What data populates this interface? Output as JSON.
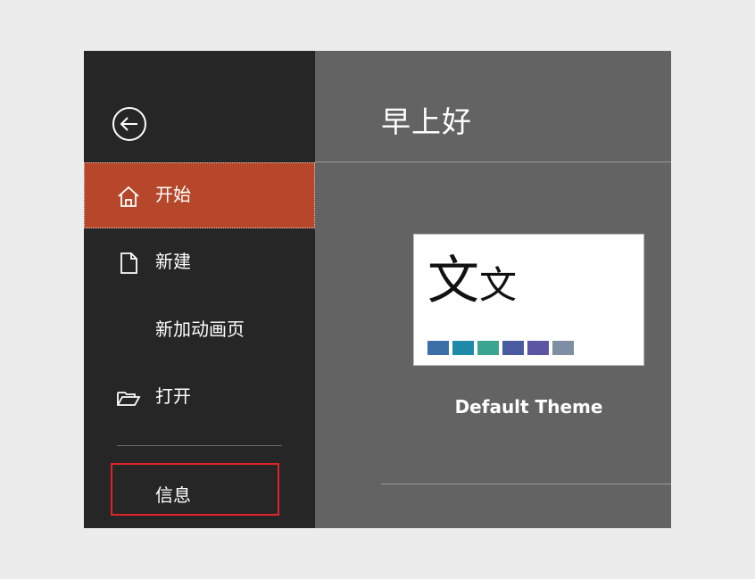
{
  "greeting": "早上好",
  "sidebar": {
    "back_icon": "back-arrow-circle-icon",
    "items": [
      {
        "label": "开始",
        "icon": "home-icon",
        "active": true
      },
      {
        "label": "新建",
        "icon": "new-document-icon"
      },
      {
        "label": "新加动画页"
      },
      {
        "label": "打开",
        "icon": "open-folder-icon"
      },
      {
        "label": "信息",
        "highlighted": true
      }
    ]
  },
  "theme": {
    "name": "Default Theme",
    "sample_big": "文",
    "sample_small": "文",
    "swatches": [
      "#3c6fa8",
      "#1f8aa8",
      "#3aa590",
      "#4a5aa0",
      "#5c55a4",
      "#7e8ea3"
    ]
  },
  "colors": {
    "accent": "#b7472a",
    "sidebar_bg": "#262626",
    "content_bg": "#636363",
    "highlight_border": "#e0242a"
  }
}
